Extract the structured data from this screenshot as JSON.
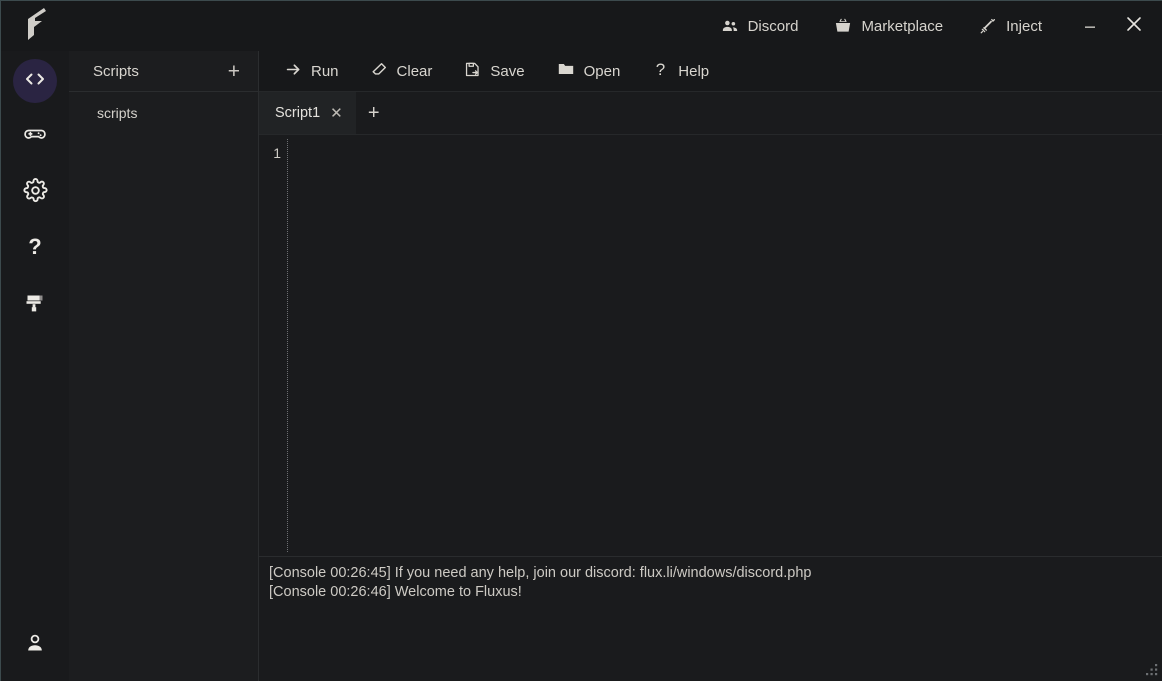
{
  "app": {
    "name": "Fluxus",
    "logo_icon": "fluxus-f-logo"
  },
  "titlebar": {
    "items": [
      {
        "label": "Discord",
        "icon": "people-icon",
        "name": "discord-button"
      },
      {
        "label": "Marketplace",
        "icon": "basket-icon",
        "name": "marketplace-button"
      },
      {
        "label": "Inject",
        "icon": "syringe-icon",
        "name": "inject-button"
      }
    ],
    "window_controls": {
      "minimize_label": "_",
      "minimize_icon": "minimize-icon",
      "close_label": "✕",
      "close_icon": "close-icon"
    }
  },
  "rail": {
    "items": [
      {
        "name": "sidebar-item-editor",
        "icon": "code-icon",
        "active": true
      },
      {
        "name": "sidebar-item-games",
        "icon": "gamepad-icon",
        "active": false
      },
      {
        "name": "sidebar-item-settings",
        "icon": "gear-icon",
        "active": false
      },
      {
        "name": "sidebar-item-help",
        "icon": "question-mark-icon",
        "active": false
      },
      {
        "name": "sidebar-item-themes",
        "icon": "paintbrush-icon",
        "active": false
      }
    ],
    "bottom_item": {
      "name": "sidebar-item-account",
      "icon": "person-icon"
    }
  },
  "scripts_panel": {
    "title": "Scripts",
    "add_label": "+",
    "add_icon": "plus-icon",
    "items": [
      {
        "label": "scripts"
      }
    ]
  },
  "toolbar": {
    "buttons": [
      {
        "label": "Run",
        "icon": "arrow-right-icon",
        "name": "run-button"
      },
      {
        "label": "Clear",
        "icon": "eraser-icon",
        "name": "clear-button"
      },
      {
        "label": "Save",
        "icon": "save-as-icon",
        "name": "save-button"
      },
      {
        "label": "Open",
        "icon": "folder-icon",
        "name": "open-button"
      },
      {
        "label": "Help",
        "icon": "question-mark-icon",
        "name": "help-button"
      }
    ]
  },
  "tabs": {
    "items": [
      {
        "label": "Script1",
        "close_label": "✕",
        "active": true
      }
    ],
    "add_label": "+",
    "add_icon": "plus-icon"
  },
  "editor": {
    "line_numbers": "1",
    "content": ""
  },
  "console": {
    "lines": [
      "[Console 00:26:45] If you need any help, join our discord: flux.li/windows/discord.php",
      "[Console 00:26:46] Welcome to Fluxus!"
    ]
  },
  "colors": {
    "window_bg": "#1a1b1d",
    "titlebar_bg": "#17181a",
    "panel_bg": "#1c1d1f",
    "accent_active": "#2a2442",
    "text": "#d8d5cf",
    "border": "#2b2d2f",
    "window_edge": "#3c4a4d"
  }
}
